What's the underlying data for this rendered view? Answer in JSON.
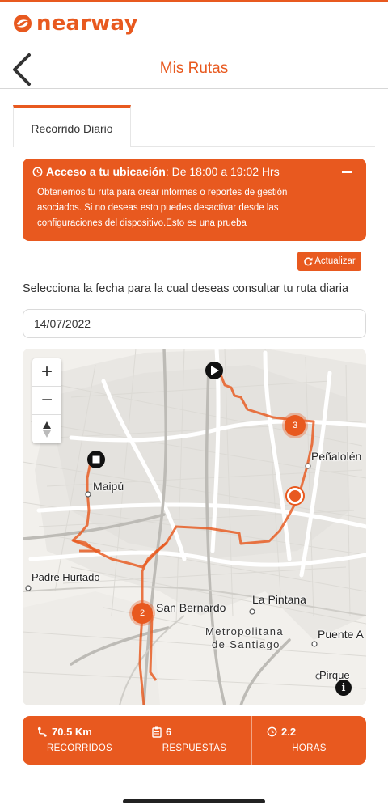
{
  "brand": {
    "name": "nearway",
    "color": "#e8591f"
  },
  "header": {
    "title": "Mis Rutas",
    "back_icon": "chevron-left-icon"
  },
  "tabs": [
    {
      "label": "Recorrido Diario",
      "active": true
    }
  ],
  "alert": {
    "icon": "clock-icon",
    "title": "Acceso a tu ubicación",
    "time_range": " : De 18:00 a 19:02 Hrs",
    "body": "Obtenemos tu ruta para crear informes o reportes de gestión asociados. Si no deseas esto puedes desactivar desde las configuraciones del dispositivo.Esto es una prueba",
    "collapse_icon": "minus-icon"
  },
  "refresh_button": {
    "label": "Actualizar",
    "icon": "refresh-icon"
  },
  "date_prompt": "Selecciona la fecha para la cual deseas consultar tu ruta diaria",
  "date_input": {
    "value": "14/07/2022"
  },
  "map": {
    "zoom_in": "+",
    "zoom_out": "−",
    "labels": {
      "maipu": "Maipú",
      "penalolen": "Peñalolén",
      "padre_hurtado": "Padre Hurtado",
      "san_bernardo": "San Bernardo",
      "la_pintana": "La Pintana",
      "metropolitana": "Metropolitana",
      "de_santiago": "de Santiago",
      "puente_alto": "Puente A",
      "pirque": "Pirque"
    },
    "clusters": {
      "north": "3",
      "south": "2"
    },
    "info": "i",
    "route_color": "#e8591f"
  },
  "stats": [
    {
      "value": "70.5 Km",
      "label": "RECORRIDOS",
      "icon": "route-icon"
    },
    {
      "value": "6",
      "label": "RESPUESTAS",
      "icon": "clipboard-icon"
    },
    {
      "value": "2.2",
      "label": "HORAS",
      "icon": "clock-icon"
    }
  ]
}
